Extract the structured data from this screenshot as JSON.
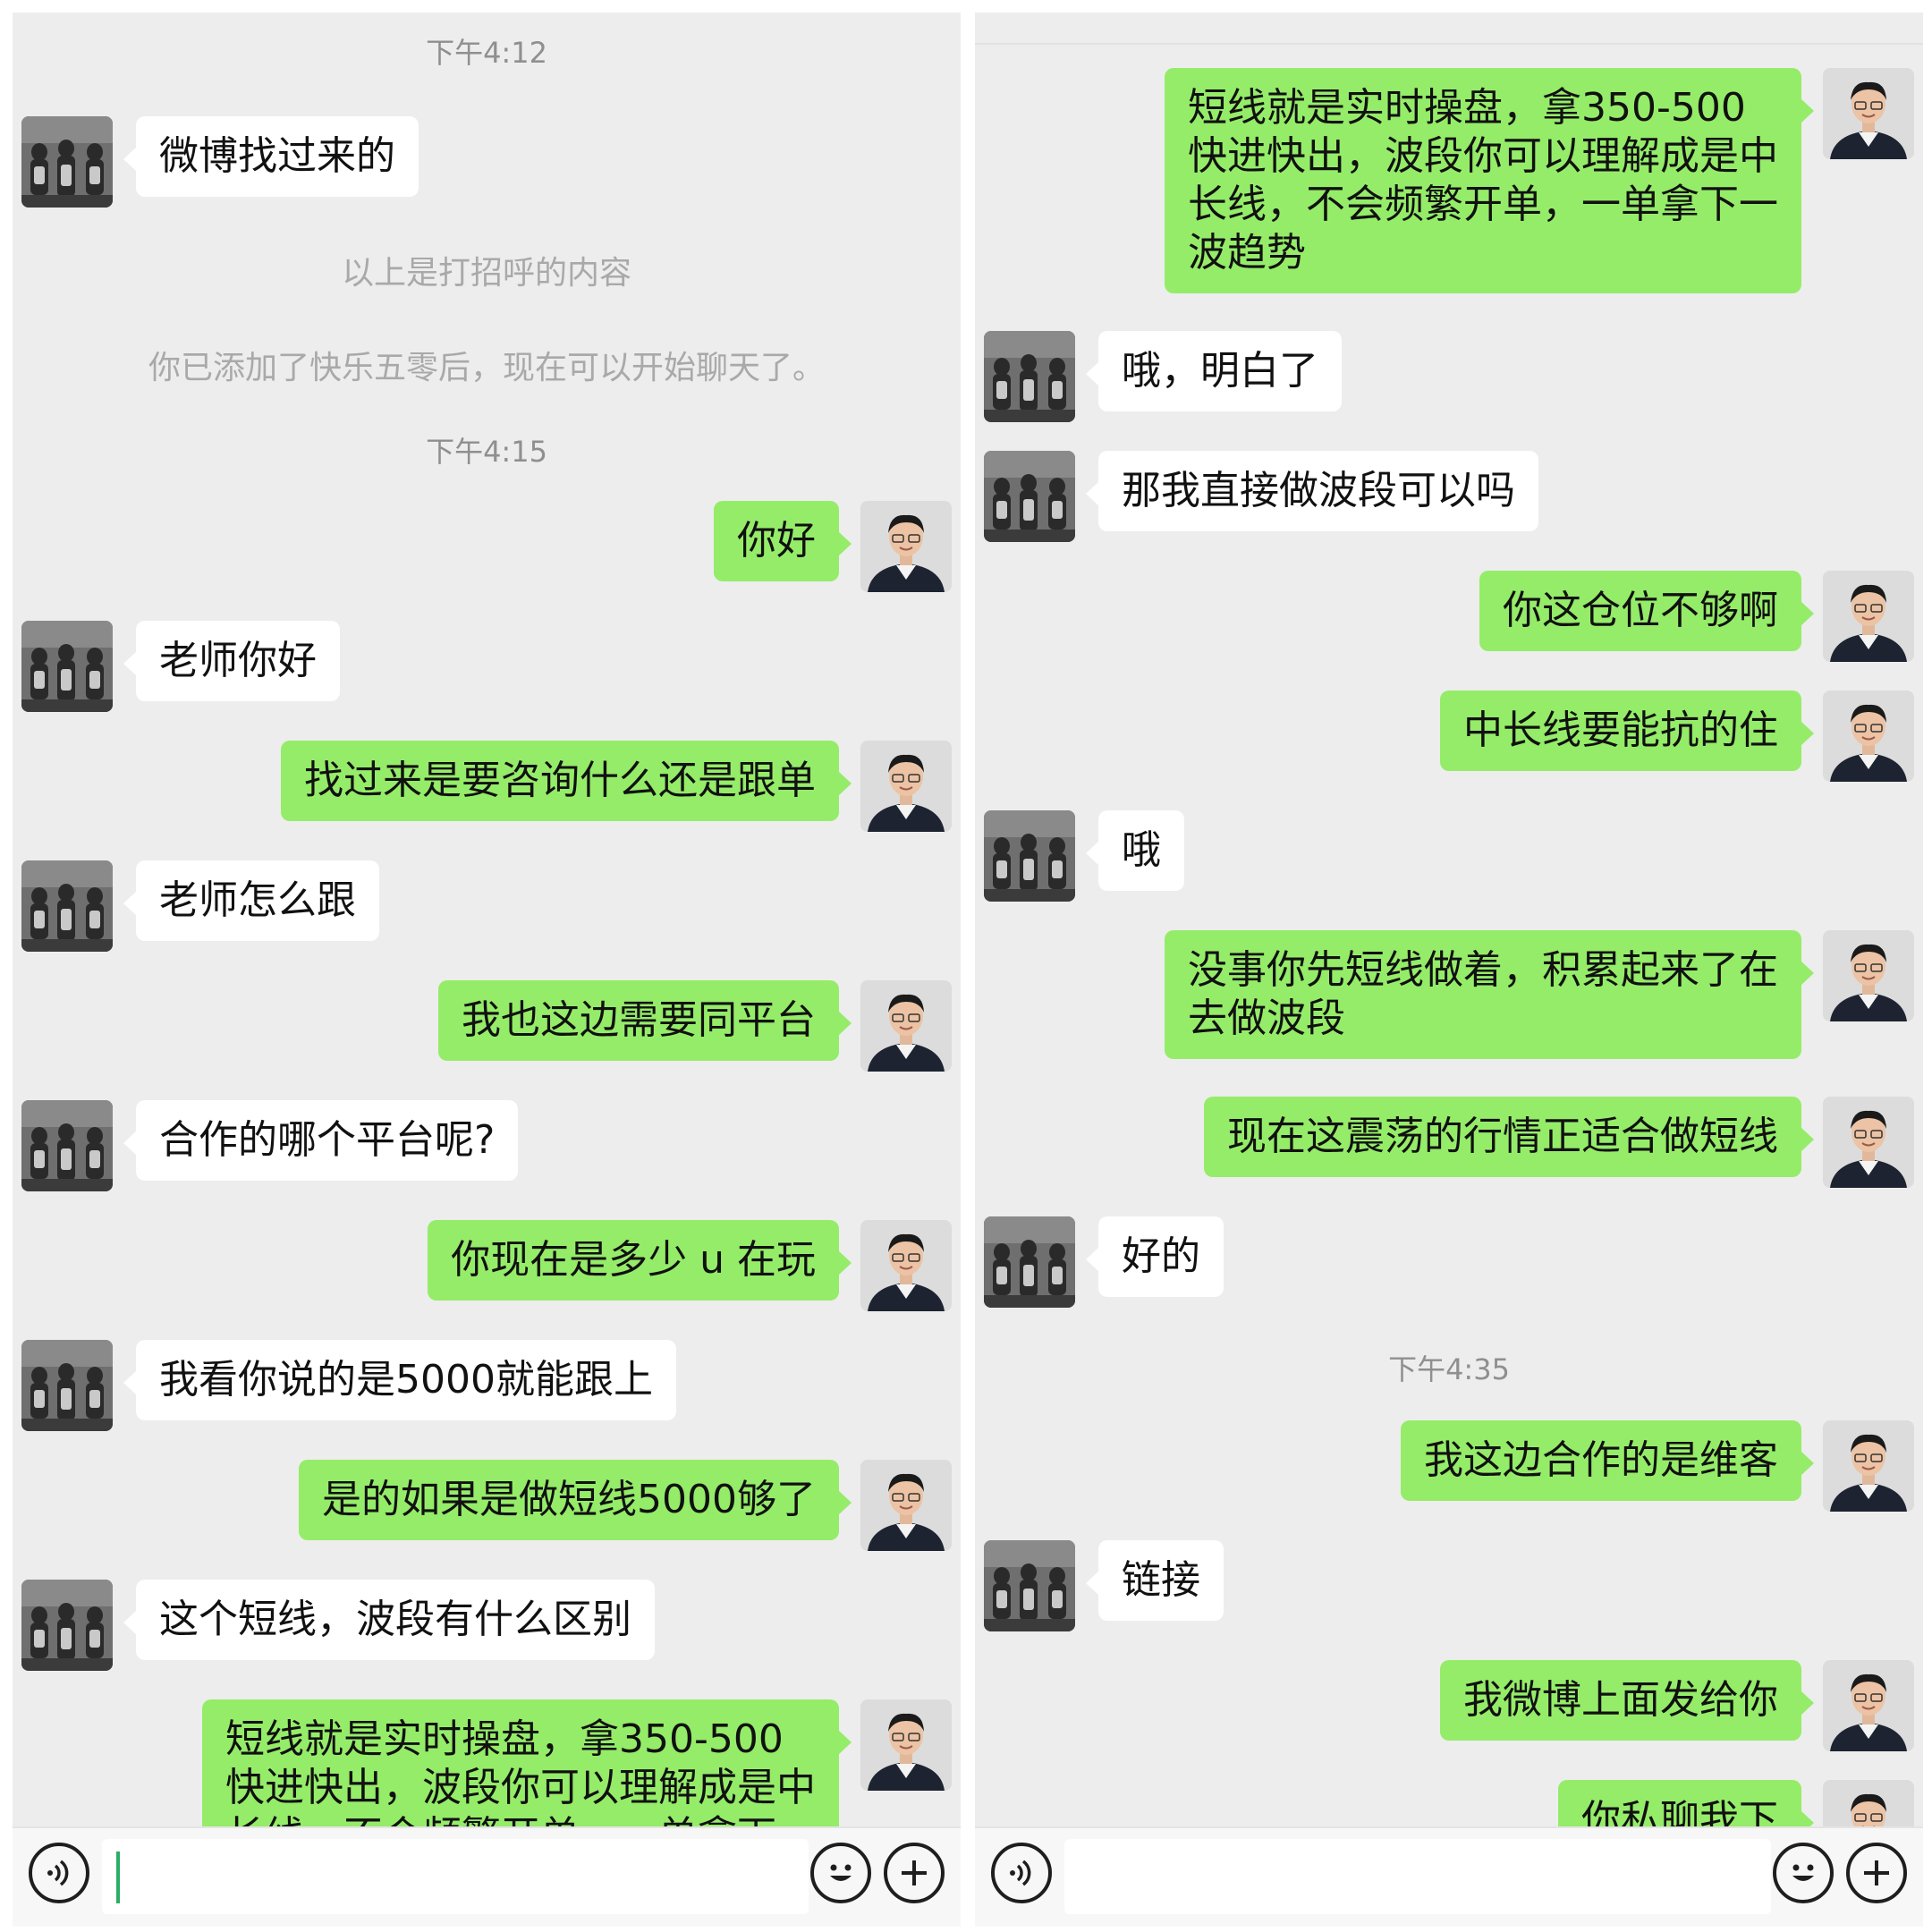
{
  "left_panel": {
    "timestamps": [
      "下午4:12",
      "下午4:15"
    ],
    "system_messages": [
      "以上是打招呼的内容",
      "你已添加了快乐五零后，现在可以开始聊天了。"
    ],
    "messages": [
      {
        "side": "in",
        "text": "微博找过来的"
      },
      {
        "side": "out",
        "text": "你好"
      },
      {
        "side": "in",
        "text": "老师你好"
      },
      {
        "side": "out",
        "text": "找过来是要咨询什么还是跟单"
      },
      {
        "side": "in",
        "text": "老师怎么跟"
      },
      {
        "side": "out",
        "text": "我也这边需要同平台"
      },
      {
        "side": "in",
        "text": "合作的哪个平台呢?"
      },
      {
        "side": "out",
        "text": "你现在是多少 u 在玩"
      },
      {
        "side": "in",
        "text": "我看你说的是5000就能跟上"
      },
      {
        "side": "out",
        "text": "是的如果是做短线5000够了"
      },
      {
        "side": "in",
        "text": "这个短线，波段有什么区别"
      },
      {
        "side": "out",
        "text": "短线就是实时操盘，拿350-500\n快进快出，波段你可以理解成是中\n长线，不会频繁开单，一单拿下一"
      }
    ]
  },
  "right_panel": {
    "timestamps": [
      "下午4:35"
    ],
    "messages": [
      {
        "side": "out",
        "text": "短线就是实时操盘，拿350-500\n快进快出，波段你可以理解成是中\n长线，不会频繁开单，一单拿下一\n波趋势"
      },
      {
        "side": "in",
        "text": "哦，明白了"
      },
      {
        "side": "in",
        "text": "那我直接做波段可以吗"
      },
      {
        "side": "out",
        "text": "你这仓位不够啊"
      },
      {
        "side": "out",
        "text": "中长线要能抗的住"
      },
      {
        "side": "in",
        "text": "哦"
      },
      {
        "side": "out",
        "text": "没事你先短线做着，积累起来了在\n去做波段"
      },
      {
        "side": "out",
        "text": "现在这震荡的行情正适合做短线"
      },
      {
        "side": "in",
        "text": "好的"
      },
      {
        "side": "out",
        "text": "我这边合作的是维客"
      },
      {
        "side": "in",
        "text": "链接"
      },
      {
        "side": "out",
        "text": "我微博上面发给你"
      },
      {
        "side": "out",
        "text": "你私聊我下"
      }
    ]
  },
  "input_bar": {
    "voice_icon": "voice-icon",
    "emoji_icon": "emoji-icon",
    "plus_icon": "plus-icon"
  },
  "colors": {
    "background": "#ededed",
    "outgoing_bubble": "#95ec69",
    "incoming_bubble": "#ffffff",
    "timestamp_text": "#8f8f8f",
    "cursor": "#2bae66"
  }
}
